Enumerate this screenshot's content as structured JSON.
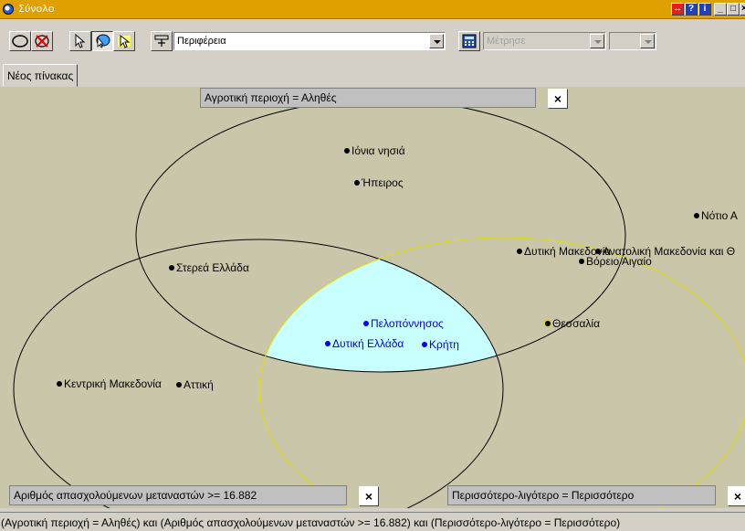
{
  "window": {
    "title": "Σύνολο",
    "controls": [
      "restore",
      "help",
      "info",
      "minimize",
      "maximize",
      "close"
    ]
  },
  "toolbar": {
    "region_combo": "Περιφέρεια",
    "measure_combo": "Μέτρησε",
    "extra_combo": ""
  },
  "tabs": [
    {
      "label": "Νέος πίνακας"
    }
  ],
  "sets": {
    "top": "Αγροτική περιοχή = Αληθές",
    "left": "Αριθμός απασχολούμενων μεταναστών >= 16.882",
    "right": "Περισσότερο-λιγότερο = Περισσότερο",
    "close_symbol": "×"
  },
  "points": {
    "ionia": "Ιόνια νησιά",
    "ipeiros": "Ήπειρος",
    "notio": "Νότιο Α",
    "dytiki_makedonia": "Δυτική Μακεδονία",
    "anatoliki": "Ανατολική Μακεδονία και Θ",
    "voreio": "Βόρειο Αιγαίο",
    "sterea": "Στερεά Ελλάδα",
    "peloponnisos": "Πελοπόννησος",
    "dytiki_ellada": "Δυτική Ελλάδα",
    "kriti": "Κρήτη",
    "thessalia": "Θεσσαλία",
    "kentriki": "Κεντρική Μακεδονία",
    "attiki": "Αττική"
  },
  "status": "(Αγροτική περιοχή = Αληθές) και (Αριθμός απασχολούμενων μεταναστών >= 16.882) και (Περισσότερο-λιγότερο = Περισσότερο)",
  "colors": {
    "canvas": "#c9c6a9",
    "intersection": "#c8ffff",
    "highlight": "#0000ee",
    "right_set": "#e0e000"
  }
}
